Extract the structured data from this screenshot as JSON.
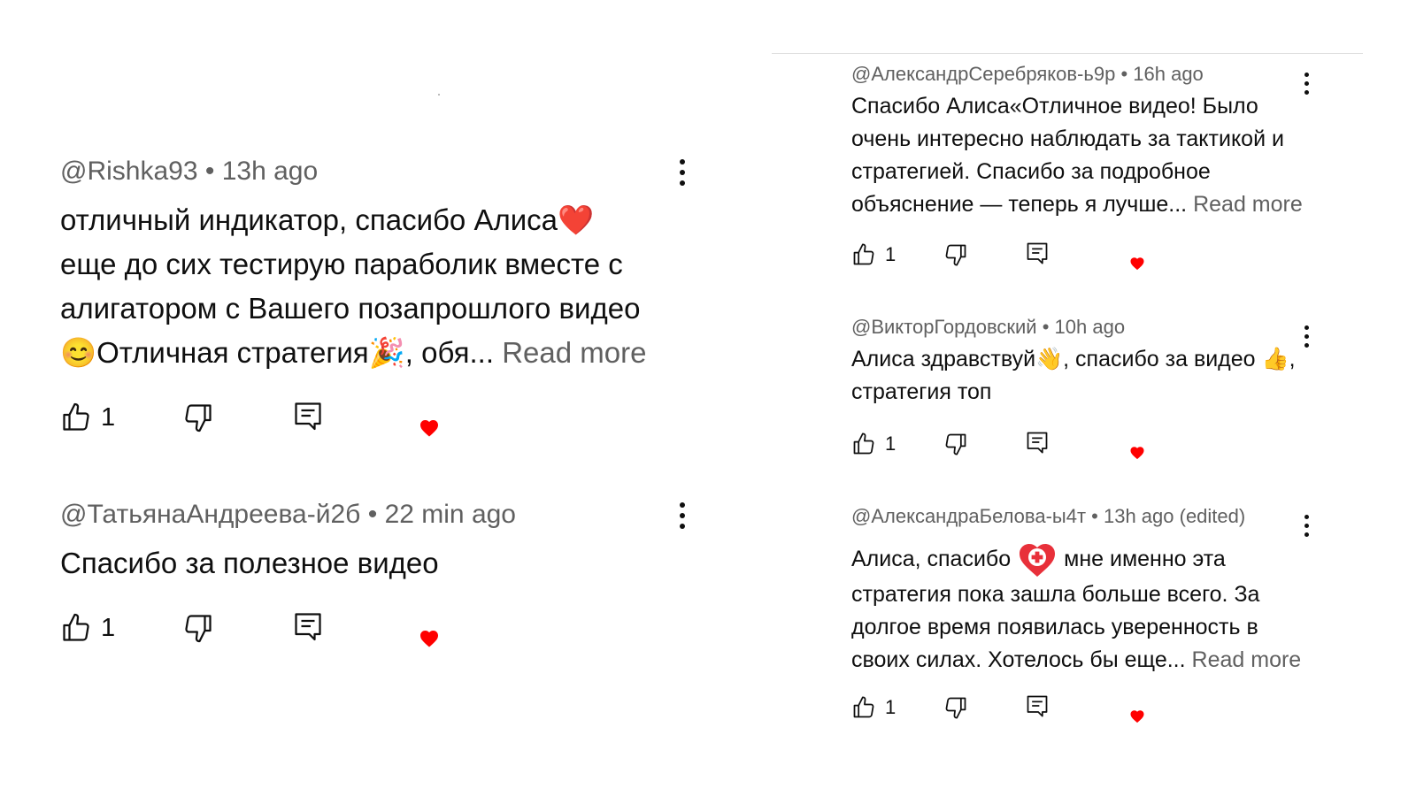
{
  "comments_left": [
    {
      "author": "@Rishka93",
      "time": "13h ago",
      "text_lines": [
        "отличный индикатор, спасибо Алиса❤️",
        "еще до сих тестирую параболик вместе с",
        "алигатором с Вашего позапрошлого видео",
        "😊Отличная стратегия🎉, обя..."
      ],
      "read_more": "Read more",
      "likes": "1"
    },
    {
      "author": "@ТатьянаАндреева-й2б",
      "time": "22 min ago",
      "text_lines": [
        "Спасибо за полезное видео"
      ],
      "likes": "1"
    }
  ],
  "comments_right": [
    {
      "author": "@АлександрСеребряков-ь9р",
      "time": "16h ago",
      "text_lines": [
        "Спасибо Алиса«Отличное видео! Было",
        "очень интересно наблюдать за тактикой и",
        "стратегией. Спасибо за подробное",
        "объяснение — теперь я лучше..."
      ],
      "read_more": "Read more",
      "likes": "1"
    },
    {
      "author": "@ВикторГордовский",
      "time": "10h ago",
      "text_lines": [
        "Алиса здравствуй👋, спасибо за видео 👍,",
        "стратегия топ"
      ],
      "likes": "1"
    },
    {
      "author": "@АлександраБелова-ы4т",
      "time": "13h ago (edited)",
      "text_lines": [
        "Алиса, спасибо",
        "мне именно эта",
        "стратегия пока зашла больше всего. За",
        "долгое время появилась уверенность в",
        "своих силах. Хотелось бы еще..."
      ],
      "read_more": "Read more",
      "likes": "1"
    }
  ],
  "icons": {
    "like": "thumb-up-icon",
    "dislike": "thumb-down-icon",
    "reply": "reply-comment-icon",
    "creator_heart": "heart-icon",
    "more": "more-vertical-icon",
    "heart_medical": "heart-with-cross-icon"
  },
  "colors": {
    "text": "#0f0f0f",
    "meta": "#606060",
    "heart": "#ff0000"
  }
}
